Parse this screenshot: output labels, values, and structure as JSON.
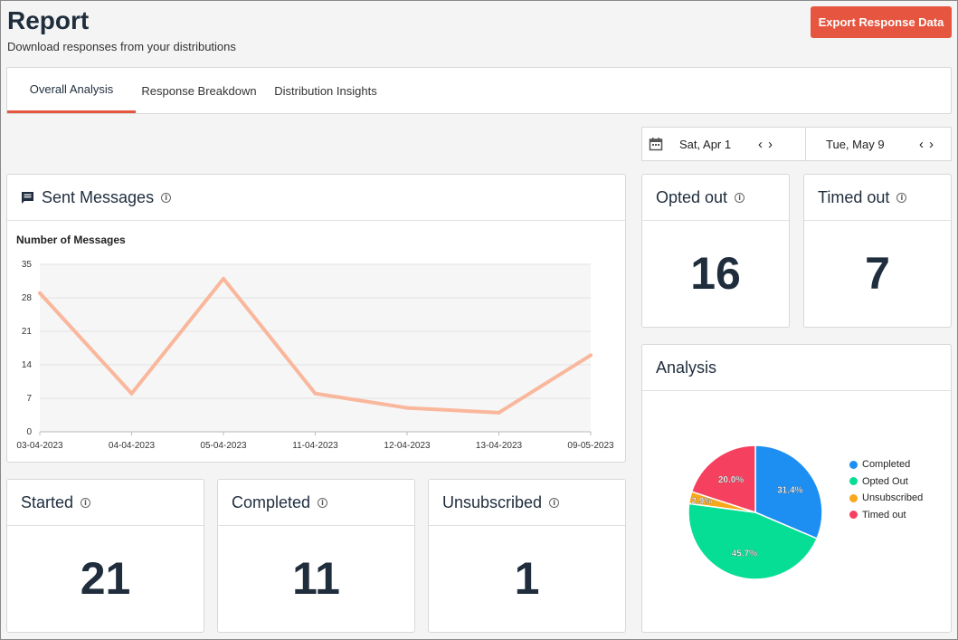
{
  "header": {
    "title": "Report",
    "subtitle": "Download responses from your distributions",
    "export_label": "Export Response Data"
  },
  "tabs": [
    {
      "label": "Overall Analysis",
      "active": true
    },
    {
      "label": "Response Breakdown",
      "active": false
    },
    {
      "label": "Distribution Insights",
      "active": false
    }
  ],
  "date_range": {
    "start": "Sat, Apr 1",
    "end": "Tue, May 9"
  },
  "sent_messages": {
    "title": "Sent Messages"
  },
  "stats": {
    "opted_out": {
      "label": "Opted out",
      "value": "16"
    },
    "timed_out": {
      "label": "Timed out",
      "value": "7"
    },
    "started": {
      "label": "Started",
      "value": "21"
    },
    "completed": {
      "label": "Completed",
      "value": "11"
    },
    "unsubscribed": {
      "label": "Unsubscribed",
      "value": "1"
    }
  },
  "analysis": {
    "title": "Analysis"
  },
  "colors": {
    "accent": "#e5553f",
    "line": "#f9b79c",
    "completed": "#1e8ff2",
    "opted_out": "#06dd95",
    "unsubscribed": "#f7a81b",
    "timed_out": "#f6405f"
  },
  "chart_data": [
    {
      "type": "line",
      "title": "Number of Messages",
      "categories": [
        "03-04-2023",
        "04-04-2023",
        "05-04-2023",
        "11-04-2023",
        "12-04-2023",
        "13-04-2023",
        "09-05-2023"
      ],
      "series": [
        {
          "values": [
            29,
            8,
            32,
            8,
            5,
            4,
            16
          ]
        }
      ],
      "yticks": [
        0,
        7,
        14,
        21,
        28,
        35
      ],
      "ylim": [
        0,
        35
      ],
      "grid": true
    },
    {
      "type": "pie",
      "labels": [
        "Completed",
        "Opted Out",
        "Unsubscribed",
        "Timed out"
      ],
      "values": [
        31.4,
        45.7,
        2.9,
        20.0
      ],
      "value_labels": [
        "31.4%",
        "45.7%",
        "2.9%",
        "20.0%"
      ],
      "legend": "right"
    }
  ]
}
